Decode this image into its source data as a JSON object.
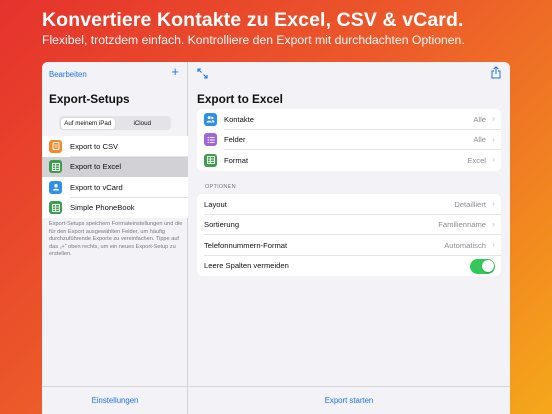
{
  "hero": {
    "title": "Konvertiere Kontakte zu Excel, CSV & vCard.",
    "subtitle": "Flexibel, trotzdem einfach. Kontrolliere den Export mit durchdachten Optionen."
  },
  "sidebar": {
    "edit_label": "Bearbeiten",
    "add_icon": "plus-icon",
    "title": "Export-Setups",
    "segments": [
      {
        "label": "Auf meinem iPad",
        "active": true
      },
      {
        "label": "iCloud",
        "active": false
      }
    ],
    "items": [
      {
        "label": "Export to CSV",
        "icon": "csv-icon",
        "color": "#f0892e",
        "selected": false
      },
      {
        "label": "Export to Excel",
        "icon": "grid-icon",
        "color": "#3e9b4f",
        "selected": true
      },
      {
        "label": "Export to vCard",
        "icon": "person-icon",
        "color": "#2f90e6",
        "selected": false
      },
      {
        "label": "Simple PhoneBook",
        "icon": "grid-icon",
        "color": "#3e9b4f",
        "selected": false
      }
    ],
    "note": "Export-Setups speichern Formateinstellungen und die für den Export ausgewählten Felder, um häufig durchzuführende Exporte zu vereinfachen. Tippe auf das „+“ oben rechts, um ein neues Export-Setup zu erstellen.",
    "settings_label": "Einstellungen"
  },
  "main": {
    "title": "Export to Excel",
    "rows": [
      {
        "label": "Kontakte",
        "value": "Alle",
        "icon": "contacts-icon",
        "color": "#2f90e6"
      },
      {
        "label": "Felder",
        "value": "Alle",
        "icon": "list-icon",
        "color": "#a066d8"
      },
      {
        "label": "Format",
        "value": "Excel",
        "icon": "grid-icon",
        "color": "#3e9b4f"
      }
    ],
    "options_header": "OPTIONEN",
    "options": [
      {
        "label": "Layout",
        "value": "Detailliert"
      },
      {
        "label": "Sortierung",
        "value": "Familienname"
      },
      {
        "label": "Telefonnummern-Format",
        "value": "Automatisch"
      }
    ],
    "toggle": {
      "label": "Leere Spalten vermeiden",
      "on": true
    },
    "start_label": "Export starten"
  },
  "colors": {
    "accent": "#1f73e8",
    "toggle_on": "#34c759"
  }
}
